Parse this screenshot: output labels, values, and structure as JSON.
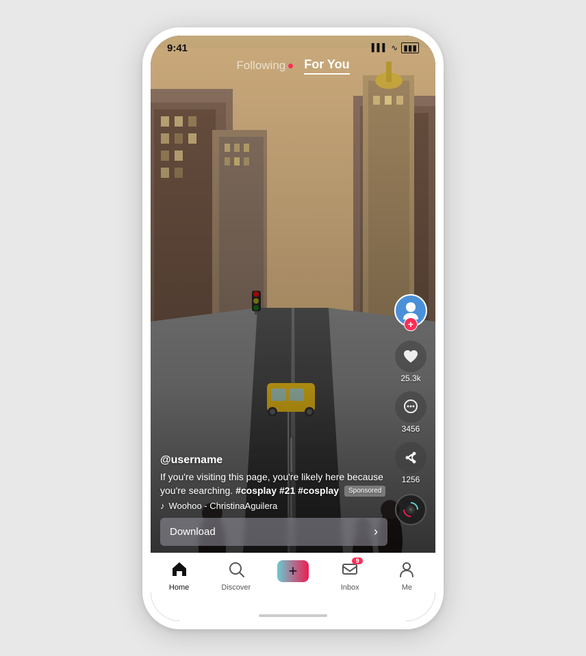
{
  "status": {
    "time": "9:41",
    "signal": "▌▌▌",
    "wifi": "WiFi",
    "battery": "🔋"
  },
  "nav": {
    "following_label": "Following",
    "foryou_label": "For You",
    "dot_color": "#ff2d55"
  },
  "video": {
    "username": "@username",
    "caption": "If you're visiting this page, you're likely here because you're searching.",
    "hashtags": "#cosplay #21 #cosplay",
    "sponsored_label": "Sponsored",
    "music_note": "♪",
    "music_name": "Woohoo - ChristinaAguilera",
    "download_label": "Download",
    "download_arrow": "›"
  },
  "actions": {
    "likes_count": "25.3k",
    "comments_count": "3456",
    "shares_count": "1256",
    "plus_symbol": "+"
  },
  "bottom_nav": {
    "home_label": "Home",
    "discover_label": "Discover",
    "inbox_label": "Inbox",
    "me_label": "Me",
    "inbox_badge": "9"
  }
}
